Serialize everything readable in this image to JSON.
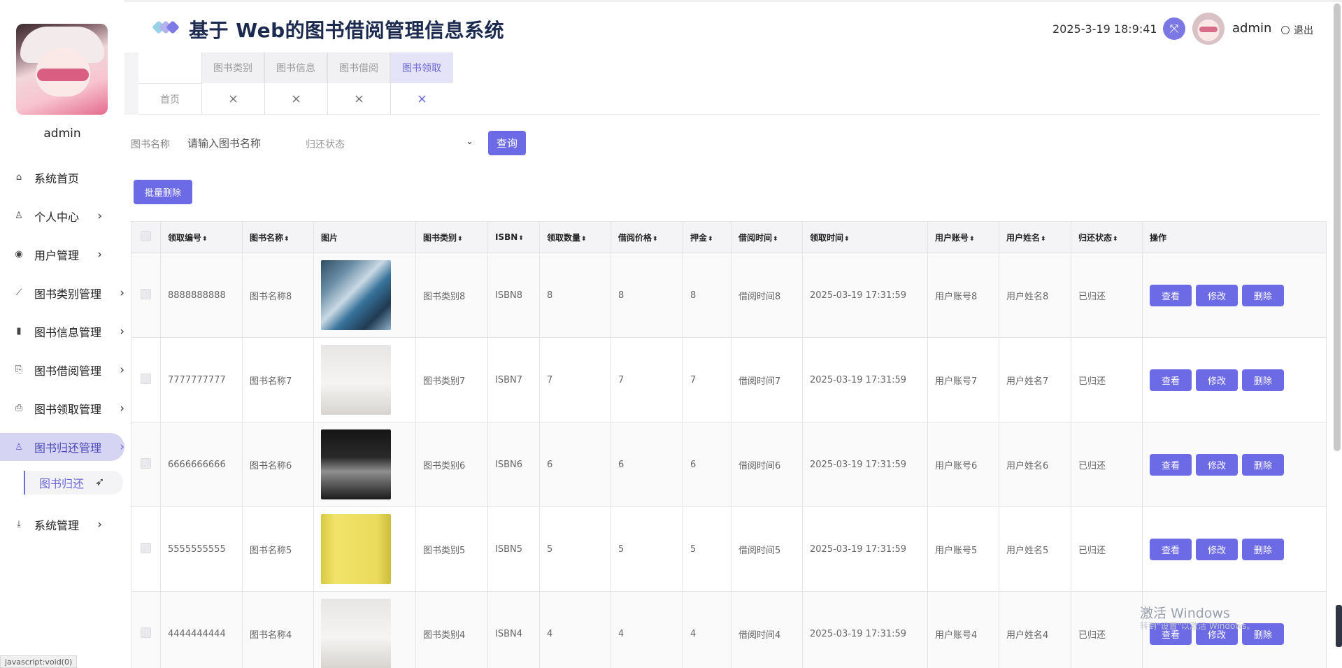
{
  "sidebar": {
    "username": "admin",
    "menu": [
      {
        "label": "系统首页",
        "icon": "home-icon",
        "arrow": false
      },
      {
        "label": "个人中心",
        "icon": "user-icon",
        "arrow": true
      },
      {
        "label": "用户管理",
        "icon": "radio-icon",
        "arrow": true
      },
      {
        "label": "图书类别管理",
        "icon": "chart-line-icon",
        "arrow": true
      },
      {
        "label": "图书信息管理",
        "icon": "bar-chart-icon",
        "arrow": true
      },
      {
        "label": "图书借阅管理",
        "icon": "task-icon",
        "arrow": true
      },
      {
        "label": "图书领取管理",
        "icon": "box-icon",
        "arrow": true
      },
      {
        "label": "图书归还管理",
        "icon": "person-icon",
        "arrow": true,
        "active": true
      },
      {
        "label": "系统管理",
        "icon": "download-icon",
        "arrow": true
      }
    ],
    "submenu_item": "图书归还"
  },
  "header": {
    "title": "基于 Web的图书借阅管理信息系统",
    "datetime": "2025-3-19 18:9:41",
    "user": "admin",
    "logout": "退出"
  },
  "tabs": {
    "top": [
      "图书类别",
      "图书信息",
      "图书借阅",
      "图书领取"
    ],
    "home": "首页",
    "close": "×"
  },
  "search": {
    "label": "图书名称",
    "placeholder": "请输入图书名称",
    "status_placeholder": "归还状态",
    "query_button": "查询",
    "batch_delete_button": "批量删除"
  },
  "table": {
    "headers": [
      "领取编号",
      "图书名称",
      "图片",
      "图书类别",
      "ISBN",
      "领取数量",
      "借阅价格",
      "押金",
      "借阅时间",
      "领取时间",
      "用户账号",
      "用户姓名",
      "归还状态",
      "操作"
    ],
    "sortable": [
      true,
      true,
      false,
      true,
      true,
      true,
      true,
      true,
      true,
      true,
      true,
      true,
      true,
      false
    ],
    "actions": [
      "查看",
      "修改",
      "删除"
    ],
    "rows": [
      {
        "id": "8888888888",
        "name": "图书名称8",
        "category": "图书类别8",
        "isbn": "ISBN8",
        "qty": "8",
        "price": "8",
        "deposit": "8",
        "borrow_time": "借阅时间8",
        "receive_time": "2025-03-19 17:31:59",
        "account": "用户账号8",
        "uname": "用户姓名8",
        "status": "已归还",
        "img": "blue-book-cover"
      },
      {
        "id": "7777777777",
        "name": "图书名称7",
        "category": "图书类别7",
        "isbn": "ISBN7",
        "qty": "7",
        "price": "7",
        "deposit": "7",
        "borrow_time": "借阅时间7",
        "receive_time": "2025-03-19 17:31:59",
        "account": "用户账号7",
        "uname": "用户姓名7",
        "status": "已归还",
        "img": "white-book-cover"
      },
      {
        "id": "6666666666",
        "name": "图书名称6",
        "category": "图书类别6",
        "isbn": "ISBN6",
        "qty": "6",
        "price": "6",
        "deposit": "6",
        "borrow_time": "借阅时间6",
        "receive_time": "2025-03-19 17:31:59",
        "account": "用户账号6",
        "uname": "用户姓名6",
        "status": "已归还",
        "img": "black-book-cover"
      },
      {
        "id": "5555555555",
        "name": "图书名称5",
        "category": "图书类别5",
        "isbn": "ISBN5",
        "qty": "5",
        "price": "5",
        "deposit": "5",
        "borrow_time": "借阅时间5",
        "receive_time": "2025-03-19 17:31:59",
        "account": "用户账号5",
        "uname": "用户姓名5",
        "status": "已归还",
        "img": "yellow-book-cover"
      },
      {
        "id": "4444444444",
        "name": "图书名称4",
        "category": "图书类别4",
        "isbn": "ISBN4",
        "qty": "4",
        "price": "4",
        "deposit": "4",
        "borrow_time": "借阅时间4",
        "receive_time": "2025-03-19 17:31:59",
        "account": "用户账号4",
        "uname": "用户姓名4",
        "status": "已归还",
        "img": "white-book-cover"
      }
    ]
  },
  "overlay": {
    "watermark": "激活 Windows",
    "watermark_sub": "转到\"设置\"以激活 Windows。",
    "status_bar": "javascript:void(0)"
  },
  "colors": {
    "accent": "#6d6ae6",
    "title": "#1b2a4e",
    "active_menu_bg": "#d6d4f3"
  }
}
